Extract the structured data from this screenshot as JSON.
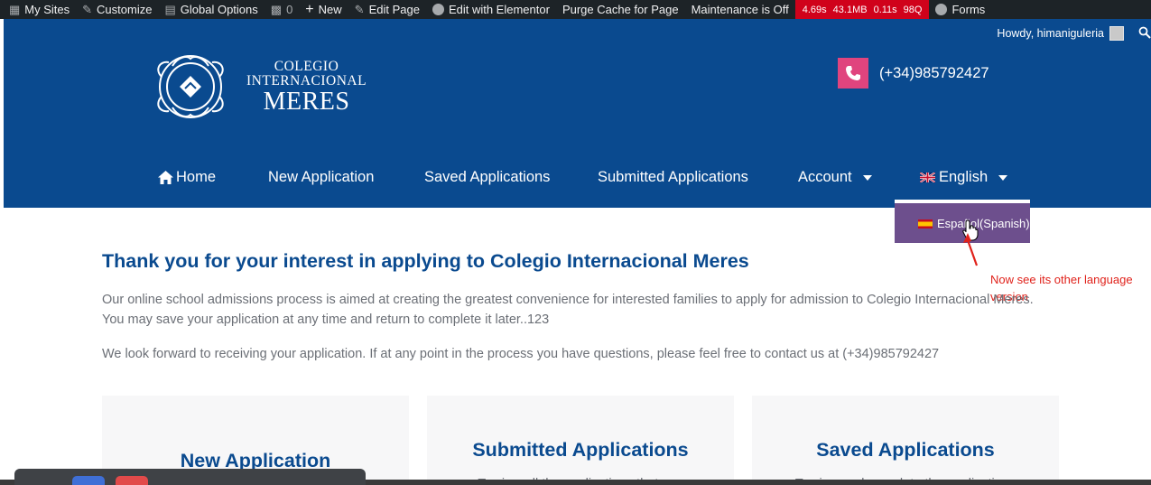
{
  "adminbar": {
    "my_sites": "My Sites",
    "customize": "Customize",
    "global_options": "Global Options",
    "comments_count": "0",
    "new": "New",
    "edit_page": "Edit Page",
    "edit_elementor": "Edit with Elementor",
    "purge_cache": "Purge Cache for Page",
    "maintenance": "Maintenance is Off",
    "perf": {
      "time": "4.69s",
      "memory": "43.1MB",
      "queries_time": "0.11s",
      "queries": "98Q",
      "color": "#d0021b"
    },
    "forms": "Forms"
  },
  "header": {
    "howdy": "Howdy, himaniguleria",
    "logo": {
      "line1": "COLEGIO",
      "line2": "INTERNACIONAL",
      "line3": "MERES"
    },
    "phone": "(+34)985792427",
    "bg_color": "#0a4a8f",
    "accent_color": "#e0447e"
  },
  "nav": {
    "home": "Home",
    "new_application": "New Application",
    "saved_applications": "Saved Applications",
    "submitted_applications": "Submitted Applications",
    "account": "Account",
    "language": "English"
  },
  "lang_dropdown": {
    "option": "Español(Spanish)",
    "bg_color": "#6d4f8d"
  },
  "annotation": {
    "text": "Now see its other language version"
  },
  "main": {
    "title": "Thank you for your interest in applying to Colegio Internacional Meres",
    "paragraph1": "Our online school admissions process is aimed at creating the greatest convenience for interested families to apply for admission to Colegio Internacional Meres. You may save your application at any time and return to complete it later..123",
    "paragraph2": "We look forward to receiving your application. If at any point in the process you have questions, please feel free to contact us at (+34)985792427",
    "cards": [
      {
        "title": "New Application",
        "text": ""
      },
      {
        "title": "Submitted Applications",
        "text": "To view all the applications that you"
      },
      {
        "title": "Saved Applications",
        "text": "To view and complete the applications"
      }
    ]
  }
}
